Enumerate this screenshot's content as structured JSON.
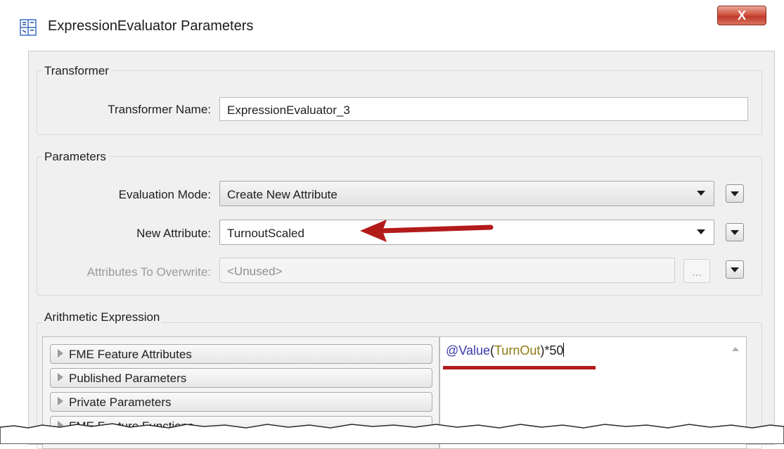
{
  "window": {
    "title": "ExpressionEvaluator Parameters",
    "icon": "grid-icon",
    "close_label": "X"
  },
  "transformer_group": {
    "title": "Transformer",
    "name_label": "Transformer Name:",
    "name_value": "ExpressionEvaluator_3"
  },
  "parameters_group": {
    "title": "Parameters",
    "evaluation_mode_label": "Evaluation Mode:",
    "evaluation_mode_value": "Create New Attribute",
    "new_attribute_label": "New Attribute:",
    "new_attribute_value": "TurnoutScaled",
    "overwrite_label": "Attributes To Overwrite:",
    "overwrite_value": "<Unused>",
    "ellipsis_label": "..."
  },
  "arithmetic_group": {
    "title": "Arithmetic Expression",
    "tree_items": [
      "FME Feature Attributes",
      "Published Parameters",
      "Private Parameters",
      "FME Feature Functions"
    ],
    "expression": {
      "func": "@Value",
      "open": "(",
      "attr": "TurnOut",
      "close": ")",
      "rest": "*50"
    }
  },
  "colors": {
    "annotation_red": "#b31b1b",
    "func_blue": "#3a3aa8",
    "attr_olive": "#8f7a12"
  }
}
